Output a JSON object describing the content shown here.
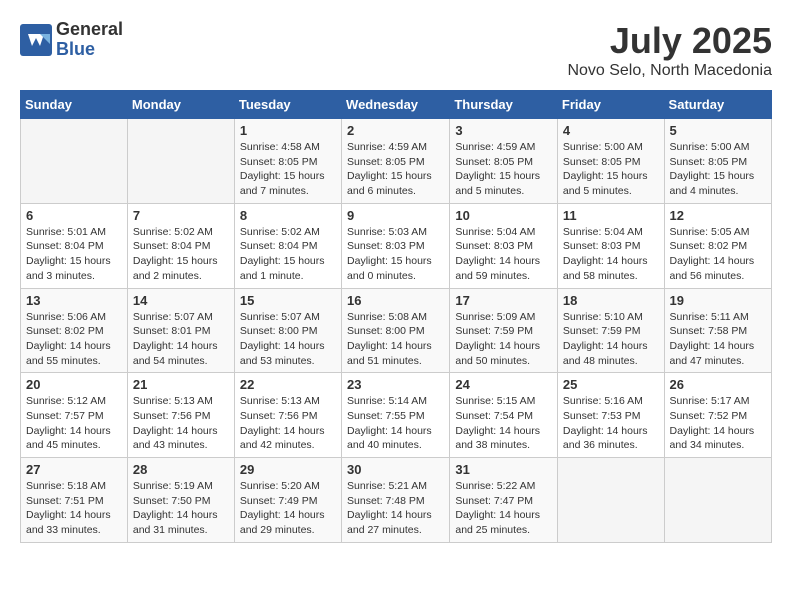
{
  "header": {
    "logo_general": "General",
    "logo_blue": "Blue",
    "month_title": "July 2025",
    "location": "Novo Selo, North Macedonia"
  },
  "weekdays": [
    "Sunday",
    "Monday",
    "Tuesday",
    "Wednesday",
    "Thursday",
    "Friday",
    "Saturday"
  ],
  "weeks": [
    [
      {
        "day": "",
        "info": ""
      },
      {
        "day": "",
        "info": ""
      },
      {
        "day": "1",
        "info": "Sunrise: 4:58 AM\nSunset: 8:05 PM\nDaylight: 15 hours\nand 7 minutes."
      },
      {
        "day": "2",
        "info": "Sunrise: 4:59 AM\nSunset: 8:05 PM\nDaylight: 15 hours\nand 6 minutes."
      },
      {
        "day": "3",
        "info": "Sunrise: 4:59 AM\nSunset: 8:05 PM\nDaylight: 15 hours\nand 5 minutes."
      },
      {
        "day": "4",
        "info": "Sunrise: 5:00 AM\nSunset: 8:05 PM\nDaylight: 15 hours\nand 5 minutes."
      },
      {
        "day": "5",
        "info": "Sunrise: 5:00 AM\nSunset: 8:05 PM\nDaylight: 15 hours\nand 4 minutes."
      }
    ],
    [
      {
        "day": "6",
        "info": "Sunrise: 5:01 AM\nSunset: 8:04 PM\nDaylight: 15 hours\nand 3 minutes."
      },
      {
        "day": "7",
        "info": "Sunrise: 5:02 AM\nSunset: 8:04 PM\nDaylight: 15 hours\nand 2 minutes."
      },
      {
        "day": "8",
        "info": "Sunrise: 5:02 AM\nSunset: 8:04 PM\nDaylight: 15 hours\nand 1 minute."
      },
      {
        "day": "9",
        "info": "Sunrise: 5:03 AM\nSunset: 8:03 PM\nDaylight: 15 hours\nand 0 minutes."
      },
      {
        "day": "10",
        "info": "Sunrise: 5:04 AM\nSunset: 8:03 PM\nDaylight: 14 hours\nand 59 minutes."
      },
      {
        "day": "11",
        "info": "Sunrise: 5:04 AM\nSunset: 8:03 PM\nDaylight: 14 hours\nand 58 minutes."
      },
      {
        "day": "12",
        "info": "Sunrise: 5:05 AM\nSunset: 8:02 PM\nDaylight: 14 hours\nand 56 minutes."
      }
    ],
    [
      {
        "day": "13",
        "info": "Sunrise: 5:06 AM\nSunset: 8:02 PM\nDaylight: 14 hours\nand 55 minutes."
      },
      {
        "day": "14",
        "info": "Sunrise: 5:07 AM\nSunset: 8:01 PM\nDaylight: 14 hours\nand 54 minutes."
      },
      {
        "day": "15",
        "info": "Sunrise: 5:07 AM\nSunset: 8:00 PM\nDaylight: 14 hours\nand 53 minutes."
      },
      {
        "day": "16",
        "info": "Sunrise: 5:08 AM\nSunset: 8:00 PM\nDaylight: 14 hours\nand 51 minutes."
      },
      {
        "day": "17",
        "info": "Sunrise: 5:09 AM\nSunset: 7:59 PM\nDaylight: 14 hours\nand 50 minutes."
      },
      {
        "day": "18",
        "info": "Sunrise: 5:10 AM\nSunset: 7:59 PM\nDaylight: 14 hours\nand 48 minutes."
      },
      {
        "day": "19",
        "info": "Sunrise: 5:11 AM\nSunset: 7:58 PM\nDaylight: 14 hours\nand 47 minutes."
      }
    ],
    [
      {
        "day": "20",
        "info": "Sunrise: 5:12 AM\nSunset: 7:57 PM\nDaylight: 14 hours\nand 45 minutes."
      },
      {
        "day": "21",
        "info": "Sunrise: 5:13 AM\nSunset: 7:56 PM\nDaylight: 14 hours\nand 43 minutes."
      },
      {
        "day": "22",
        "info": "Sunrise: 5:13 AM\nSunset: 7:56 PM\nDaylight: 14 hours\nand 42 minutes."
      },
      {
        "day": "23",
        "info": "Sunrise: 5:14 AM\nSunset: 7:55 PM\nDaylight: 14 hours\nand 40 minutes."
      },
      {
        "day": "24",
        "info": "Sunrise: 5:15 AM\nSunset: 7:54 PM\nDaylight: 14 hours\nand 38 minutes."
      },
      {
        "day": "25",
        "info": "Sunrise: 5:16 AM\nSunset: 7:53 PM\nDaylight: 14 hours\nand 36 minutes."
      },
      {
        "day": "26",
        "info": "Sunrise: 5:17 AM\nSunset: 7:52 PM\nDaylight: 14 hours\nand 34 minutes."
      }
    ],
    [
      {
        "day": "27",
        "info": "Sunrise: 5:18 AM\nSunset: 7:51 PM\nDaylight: 14 hours\nand 33 minutes."
      },
      {
        "day": "28",
        "info": "Sunrise: 5:19 AM\nSunset: 7:50 PM\nDaylight: 14 hours\nand 31 minutes."
      },
      {
        "day": "29",
        "info": "Sunrise: 5:20 AM\nSunset: 7:49 PM\nDaylight: 14 hours\nand 29 minutes."
      },
      {
        "day": "30",
        "info": "Sunrise: 5:21 AM\nSunset: 7:48 PM\nDaylight: 14 hours\nand 27 minutes."
      },
      {
        "day": "31",
        "info": "Sunrise: 5:22 AM\nSunset: 7:47 PM\nDaylight: 14 hours\nand 25 minutes."
      },
      {
        "day": "",
        "info": ""
      },
      {
        "day": "",
        "info": ""
      }
    ]
  ]
}
